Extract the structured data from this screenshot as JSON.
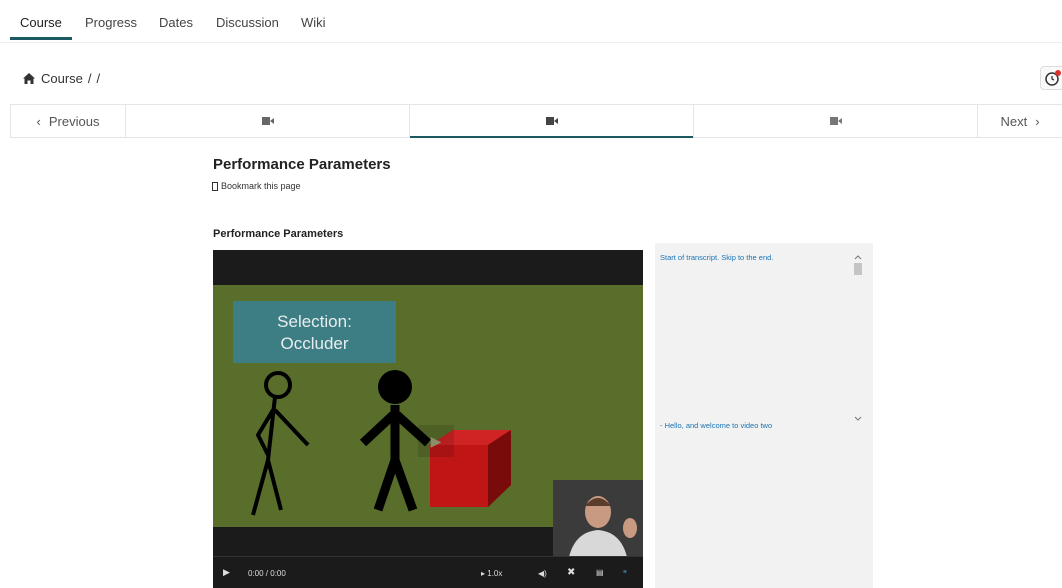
{
  "tabs": [
    "Course",
    "Progress",
    "Dates",
    "Discussion",
    "Wiki"
  ],
  "breadcrumb": {
    "home": "Course",
    "sep1": "/",
    "sep2": "/"
  },
  "seq_nav": {
    "previous": "Previous",
    "next": "Next"
  },
  "unit": {
    "title": "Performance Parameters",
    "bookmark": "Bookmark this page",
    "video_heading": "Performance Parameters"
  },
  "video": {
    "slide_title": "Selection:\nOccluder",
    "time": "0:00 / 0:00",
    "speed": "1.0x"
  },
  "transcript": {
    "start": "Start of transcript. Skip to the end.",
    "line1": "- Hello, and welcome to video two"
  },
  "colors": {
    "accent": "#1c5a62",
    "link": "#1a73b5",
    "slide_bg": "#5a6e2c",
    "title_box": "#3d7d84"
  }
}
